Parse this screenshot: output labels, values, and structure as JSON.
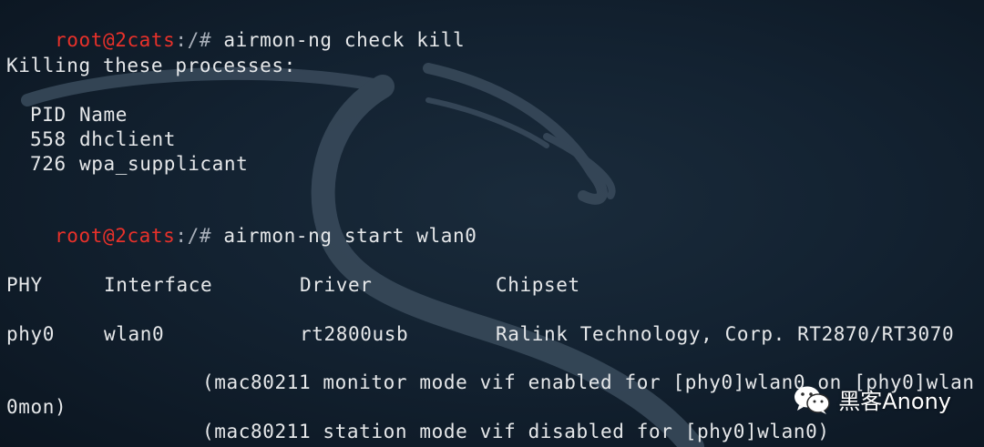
{
  "prompt": {
    "user_host": "root@2cats",
    "path": ":/# "
  },
  "commands": {
    "first": "airmon-ng check kill",
    "second": "airmon-ng start wlan0"
  },
  "kill_output": {
    "heading": "Killing these processes:",
    "header_pid": "PID",
    "header_name": "Name",
    "processes": [
      {
        "pid": "558",
        "name": "dhclient"
      },
      {
        "pid": "726",
        "name": "wpa_supplicant"
      }
    ]
  },
  "interfaces_table": {
    "headers": [
      "PHY",
      "Interface",
      "Driver",
      "Chipset"
    ],
    "rows": [
      {
        "phy": "phy0",
        "interface": "wlan0",
        "driver": "rt2800usb",
        "chipset": "Ralink Technology, Corp. RT2870/RT3070"
      }
    ],
    "note_monitor_line1": "(mac80211 monitor mode vif enabled for [phy0]wlan0 on [phy0]wlan",
    "note_monitor_line2": "0mon)",
    "note_station": "(mac80211 station mode vif disabled for [phy0]wlan0)"
  },
  "watermark": {
    "text": "黑客Anony",
    "icon": "wechat-icon"
  },
  "colors": {
    "prompt_user": "#e8312a",
    "background": "#132231",
    "text": "#e6e8ea"
  }
}
